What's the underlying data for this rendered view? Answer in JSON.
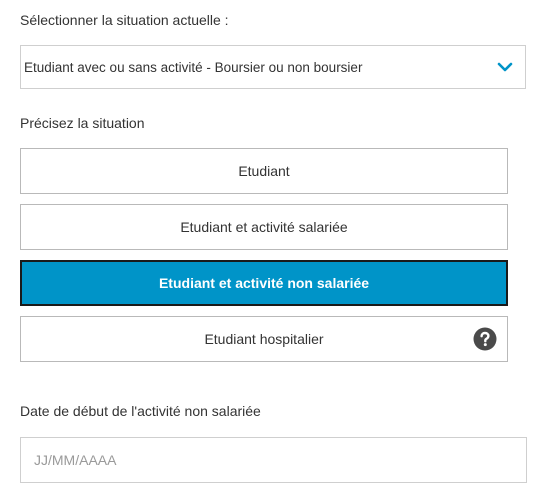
{
  "situation": {
    "label": "Sélectionner la situation actuelle :",
    "selected_value": "Etudiant avec ou sans activité - Boursier ou non boursier",
    "chevron_icon": "chevron-down-icon",
    "chevron_color": "#0094c8"
  },
  "details": {
    "label": "Précisez la situation",
    "options": [
      {
        "label": "Etudiant",
        "selected": false
      },
      {
        "label": "Etudiant et activité salariée",
        "selected": false
      },
      {
        "label": "Etudiant et activité non salariée",
        "selected": true
      },
      {
        "label": "Etudiant hospitalier",
        "selected": false,
        "has_help": true
      }
    ],
    "help_icon": "question-circle-icon",
    "selected_color": "#0094c8"
  },
  "start_date": {
    "label": "Date de début de l'activité non salariée",
    "placeholder": "JJ/MM/AAAA",
    "value": ""
  }
}
